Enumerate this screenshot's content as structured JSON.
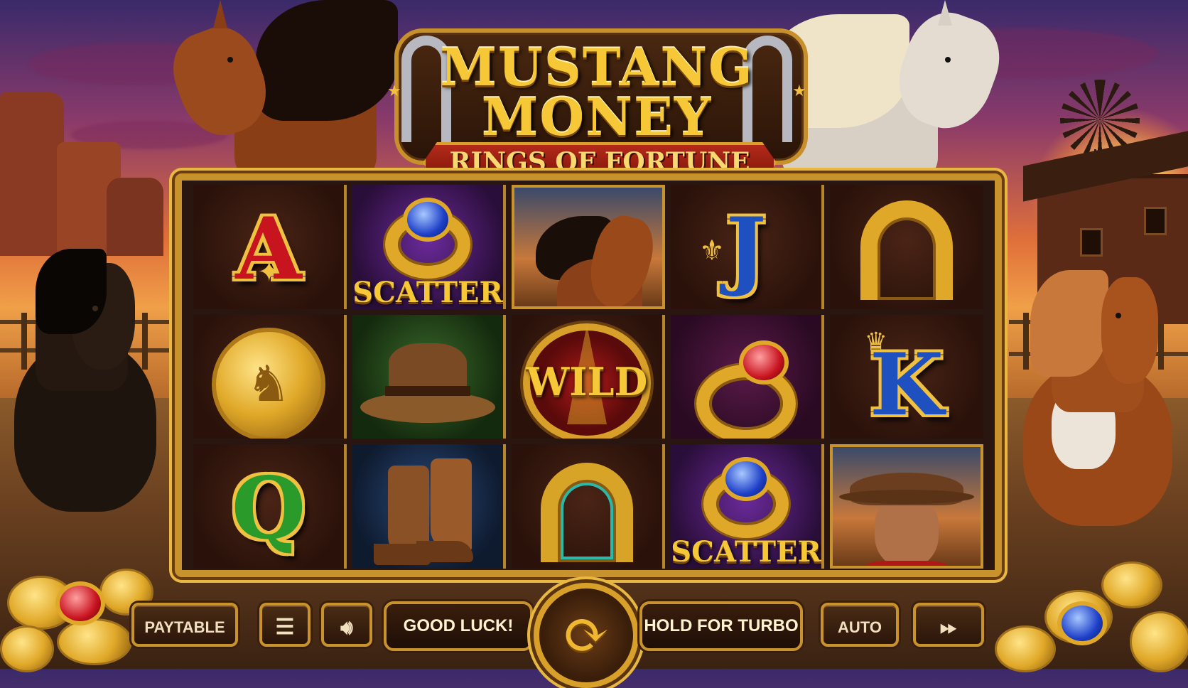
{
  "logo": {
    "line1": "MUSTANG",
    "line2": "MONEY",
    "subtitle": "RINGS OF FORTUNE"
  },
  "reels": {
    "symbols": [
      [
        "A",
        "SCATTER",
        "horse",
        "J",
        "horseshoe"
      ],
      [
        "horse-coin",
        "cowboy-hat",
        "WILD",
        "ruby-ring",
        "K"
      ],
      [
        "Q",
        "cowboy-boots",
        "turquoise-horseshoe",
        "SCATTER",
        "cowboy"
      ]
    ],
    "a": "A",
    "j": "J",
    "k": "K",
    "q": "Q",
    "scatter": "SCATTER",
    "wild": "WILD"
  },
  "controls": {
    "paytable": "PAYTABLE",
    "menu_icon": "menu-icon",
    "sound_icon": "speaker-icon",
    "message_left": "GOOD LUCK!",
    "spin_icon": "refresh-icon",
    "message_right": "HOLD FOR TURBO",
    "auto": "AUTO",
    "turbo_icon": "fast-forward-icon"
  },
  "colors": {
    "gold": "#e0a828",
    "frame": "#c8922c",
    "red_letter": "#c8141e",
    "blue_letter": "#1e50c0",
    "green_letter": "#2a9a2a"
  }
}
